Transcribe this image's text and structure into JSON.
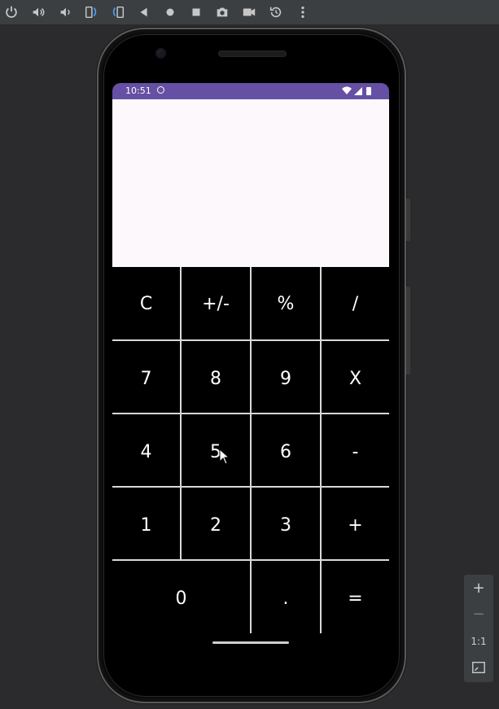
{
  "toolbar": {
    "icons": [
      "power-icon",
      "volume-up-icon",
      "volume-down-icon",
      "rotate-left-icon",
      "rotate-right-icon",
      "back-icon",
      "home-icon",
      "overview-icon",
      "camera-icon",
      "video-icon",
      "restore-icon",
      "more-icon"
    ]
  },
  "status_bar": {
    "time": "10:51",
    "background": "#6550a4"
  },
  "display": {
    "value": ""
  },
  "keypad": {
    "rows": [
      [
        "C",
        "+/-",
        "%",
        "/"
      ],
      [
        "7",
        "8",
        "9",
        "X"
      ],
      [
        "4",
        "5",
        "6",
        "-"
      ],
      [
        "1",
        "2",
        "3",
        "+"
      ],
      [
        "0",
        ".",
        "="
      ]
    ]
  },
  "zoom_controls": {
    "zoom_in": "+",
    "zoom_out": "−",
    "actual_size": "1:1"
  }
}
